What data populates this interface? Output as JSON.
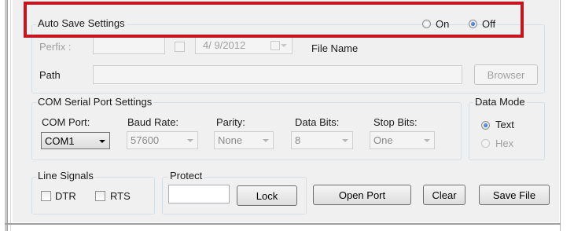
{
  "auto_save": {
    "group_label": "Auto Save Settings",
    "on_label": "On",
    "off_label": "Off",
    "selected": "Off",
    "prefix_label": "Perfix :",
    "prefix_value": "",
    "date_value": "4/ 9/2012",
    "file_name_label": "File Name",
    "path_label": "Path",
    "path_value": "",
    "browser_button": "Browser"
  },
  "com": {
    "group_label": "COM Serial Port Settings",
    "port_label": "COM Port:",
    "port_value": "COM1",
    "baud_label": "Baud Rate:",
    "baud_value": "57600",
    "parity_label": "Parity:",
    "parity_value": "None",
    "databits_label": "Data Bits:",
    "databits_value": "8",
    "stopbits_label": "Stop Bits:",
    "stopbits_value": "One"
  },
  "data_mode": {
    "group_label": "Data Mode",
    "text_label": "Text",
    "hex_label": "Hex",
    "selected": "Text"
  },
  "line_signals": {
    "group_label": "Line Signals",
    "dtr_label": "DTR",
    "rts_label": "RTS"
  },
  "protect": {
    "group_label": "Protect",
    "value": "",
    "lock_button": "Lock"
  },
  "actions": {
    "open_port": "Open Port",
    "clear": "Clear",
    "save_file": "Save File"
  },
  "colors": {
    "highlight_border": "#c4161c",
    "panel_bg": "#f0f0f0",
    "radio_selected": "#1a4fb0"
  }
}
